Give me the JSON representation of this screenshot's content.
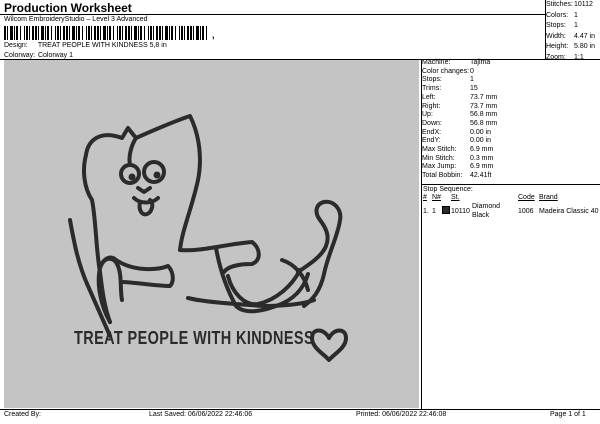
{
  "header": {
    "title": "Production Worksheet",
    "subtitle": "Wilcom EmbroideryStudio – Level 3 Advanced",
    "barcode_suffix": ",",
    "design_label": "Design:",
    "design_value": "TREAT PEOPLE WITH KINDNESS 5,8 in",
    "colorway_label": "Colorway:",
    "colorway_value": "Colorway 1"
  },
  "stats": [
    {
      "label": "Stitches:",
      "value": "10112"
    },
    {
      "label": "Colors:",
      "value": "1"
    },
    {
      "label": "Stops:",
      "value": "1"
    },
    {
      "label": "Width:",
      "value": "4.47 in"
    },
    {
      "label": "Height:",
      "value": "5.80 in"
    },
    {
      "label": "Zoom:",
      "value": "1:1"
    }
  ],
  "design_image": {
    "lettering": "TREAT PEOPLE WITH KINDNESS",
    "background_color": "#c4c4c4",
    "stitch_color": "#2b2b2b"
  },
  "machine_info": [
    {
      "label": "Machine:",
      "value": "Tajima"
    },
    {
      "label": "Color changes:",
      "value": "0"
    },
    {
      "label": "Stops:",
      "value": "1"
    },
    {
      "label": "Trims:",
      "value": "15"
    },
    {
      "label": "Left:",
      "value": "73.7 mm"
    },
    {
      "label": "Right:",
      "value": "73.7 mm"
    },
    {
      "label": "Up:",
      "value": "56.8 mm"
    },
    {
      "label": "Down:",
      "value": "56.8 mm"
    },
    {
      "label": "EndX:",
      "value": "0.00 in"
    },
    {
      "label": "EndY:",
      "value": "0.00 in"
    },
    {
      "label": "Max Stitch:",
      "value": "6.9 mm"
    },
    {
      "label": "Min Stitch:",
      "value": "0.3 mm"
    },
    {
      "label": "Max Jump:",
      "value": "6.9 mm"
    },
    {
      "label": "Total Bobbin:",
      "value": "42.41ft"
    }
  ],
  "stop_sequence": {
    "title": "Stop Sequence:",
    "headers": {
      "num": "#",
      "n": "N#",
      "st": "St.",
      "code": "Code",
      "brand": "Brand"
    },
    "rows": [
      {
        "num": "1.",
        "n": "1",
        "st": "10110",
        "name": "Diamond Black",
        "code": "1006",
        "brand": "Madeira Classic 40"
      }
    ]
  },
  "footer": {
    "created_by": "Created By:",
    "last_saved": "Last Saved: 06/06/2022 22:46:06",
    "printed": "Printed: 06/06/2022 22:46:08",
    "page": "Page 1 of 1"
  }
}
